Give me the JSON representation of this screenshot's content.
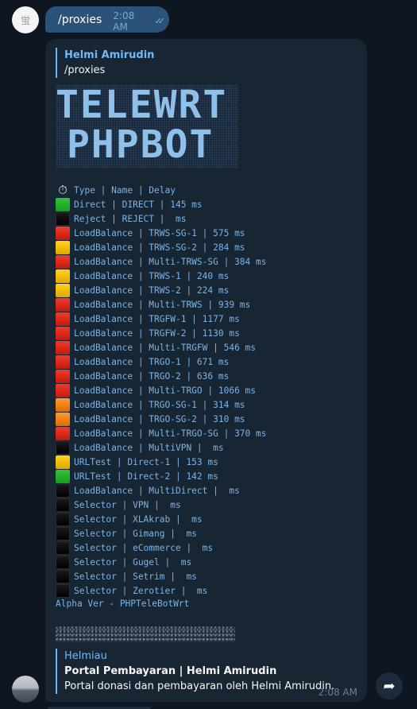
{
  "outgoing": {
    "command": "/proxies",
    "time": "2:08 AM",
    "status_icon": "double-check-icon"
  },
  "incoming": {
    "reply_name": "Helmi Amirudin",
    "reply_text": "/proxies",
    "ascii_banner": [
      "TELEWRT",
      "PHPBOT"
    ],
    "header_row": {
      "icon": "stopwatch-icon",
      "text": "Type | Name | Delay"
    },
    "rows": [
      {
        "color": "green",
        "text": "Direct | DIRECT | 145 ms"
      },
      {
        "color": "black",
        "text": "Reject | REJECT |  ms"
      },
      {
        "color": "red",
        "text": "LoadBalance | TRWS-SG-1 | 575 ms"
      },
      {
        "color": "yellow",
        "text": "LoadBalance | TRWS-SG-2 | 284 ms"
      },
      {
        "color": "red",
        "text": "LoadBalance | Multi-TRWS-SG | 384 ms"
      },
      {
        "color": "yellow",
        "text": "LoadBalance | TRWS-1 | 240 ms"
      },
      {
        "color": "yellow",
        "text": "LoadBalance | TRWS-2 | 224 ms"
      },
      {
        "color": "red",
        "text": "LoadBalance | Multi-TRWS | 939 ms"
      },
      {
        "color": "red",
        "text": "LoadBalance | TRGFW-1 | 1177 ms"
      },
      {
        "color": "red",
        "text": "LoadBalance | TRGFW-2 | 1130 ms"
      },
      {
        "color": "red",
        "text": "LoadBalance | Multi-TRGFW | 546 ms"
      },
      {
        "color": "red",
        "text": "LoadBalance | TRGO-1 | 671 ms"
      },
      {
        "color": "red",
        "text": "LoadBalance | TRGO-2 | 636 ms"
      },
      {
        "color": "red",
        "text": "LoadBalance | Multi-TRGO | 1066 ms"
      },
      {
        "color": "orange",
        "text": "LoadBalance | TRGO-SG-1 | 314 ms"
      },
      {
        "color": "orange",
        "text": "LoadBalance | TRGO-SG-2 | 310 ms"
      },
      {
        "color": "red",
        "text": "LoadBalance | Multi-TRGO-SG | 370 ms"
      },
      {
        "color": "black",
        "text": "LoadBalance | MultiVPN |  ms"
      },
      {
        "color": "yellow",
        "text": "URLTest | Direct-1 | 153 ms"
      },
      {
        "color": "green",
        "text": "URLTest | Direct-2 | 142 ms"
      },
      {
        "color": "black",
        "text": "LoadBalance | MultiDirect |  ms"
      },
      {
        "color": "black",
        "text": "Selector | VPN |  ms"
      },
      {
        "color": "black",
        "text": "Selector | XLAkrab |  ms"
      },
      {
        "color": "black",
        "text": "Selector | Gimang |  ms"
      },
      {
        "color": "black",
        "text": "Selector | eCommerce |  ms"
      },
      {
        "color": "black",
        "text": "Selector | Gugel |  ms"
      },
      {
        "color": "black",
        "text": "Selector | Setrim |  ms"
      },
      {
        "color": "black",
        "text": "Selector | Zerotier |  ms"
      }
    ],
    "footer_text": "Alpha Ver - PHPTeleBotWrt",
    "preview": {
      "site": "Helmiau",
      "title": "Portal Pembayaran | Helmi Amirudin",
      "description": "Portal donasi dan pembayaran oleh Helmi Amirudin."
    },
    "time": "2:08 AM"
  },
  "colors": {
    "background": "#0e1621",
    "outgoing_bubble": "#2b5278",
    "incoming_bubble": "#182533",
    "accent": "#71baf7",
    "mono_text": "#7ab4e8"
  },
  "share_icon": "share-arrow-icon"
}
